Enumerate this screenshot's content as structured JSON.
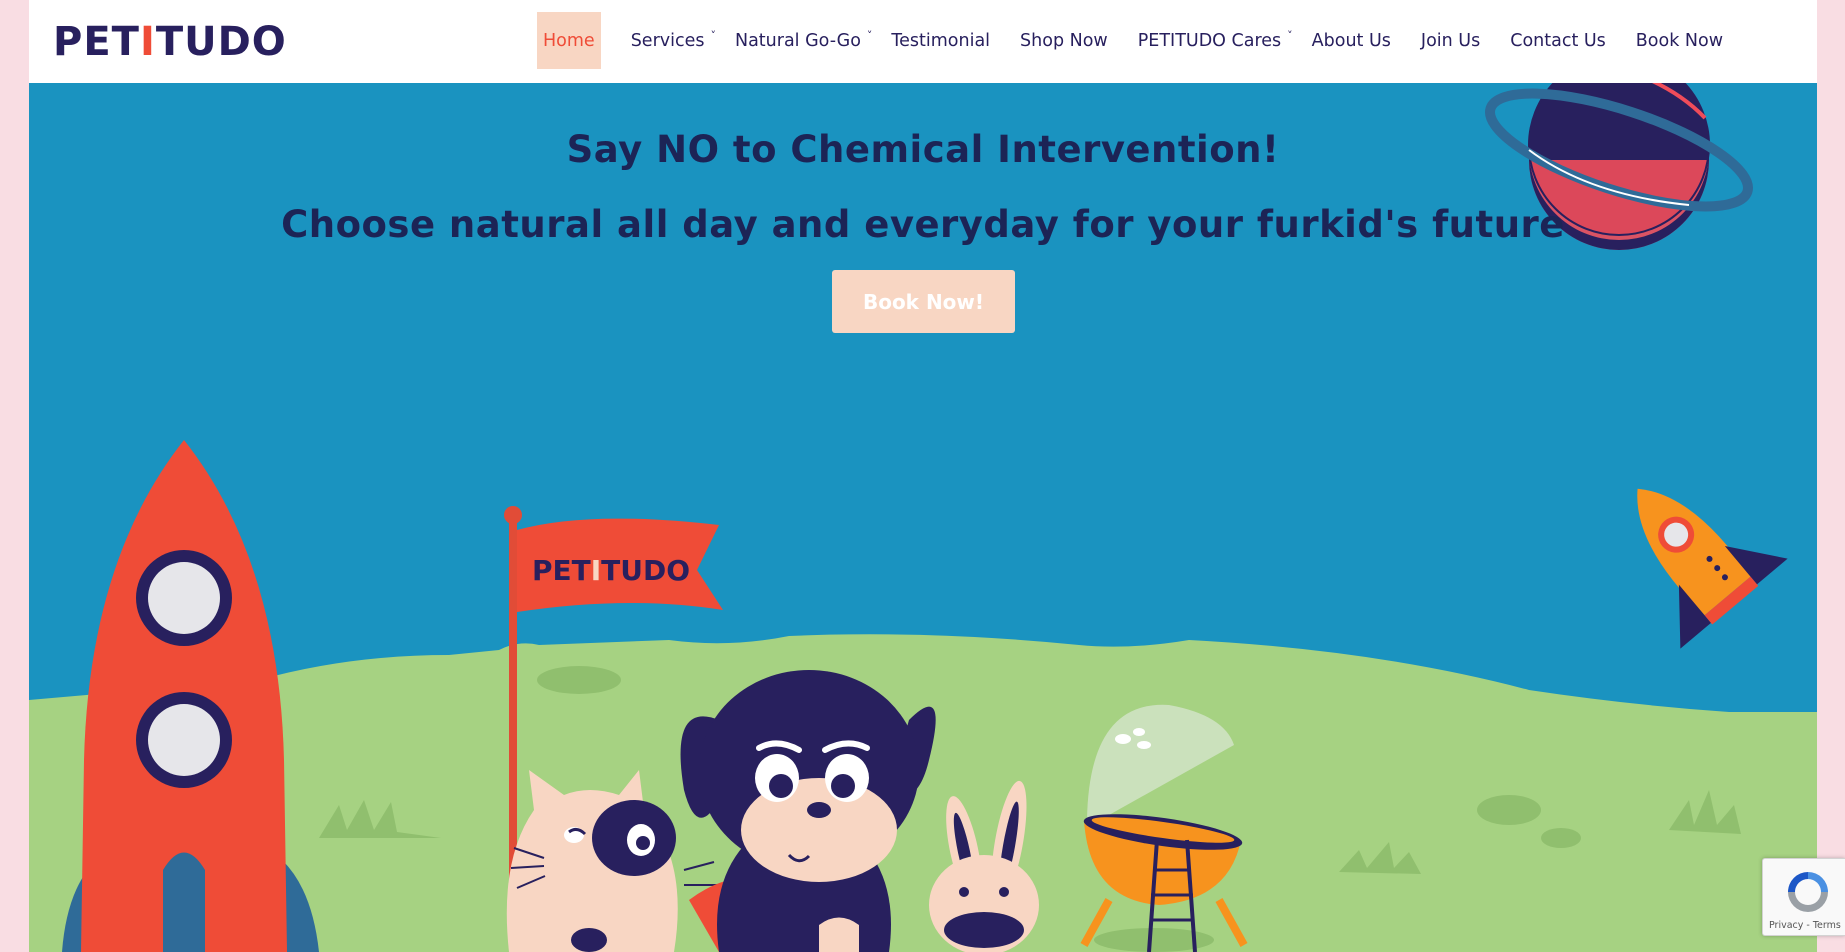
{
  "brand": {
    "logo_part1": "PET",
    "logo_bone": "I",
    "logo_part2": "TUDO"
  },
  "nav": {
    "items": [
      {
        "label": "Home",
        "active": true,
        "dropdown": false
      },
      {
        "label": "Services",
        "dropdown": true
      },
      {
        "label": "Natural Go-Go",
        "dropdown": true
      },
      {
        "label": "Testimonial",
        "dropdown": false
      },
      {
        "label": "Shop Now",
        "dropdown": false
      },
      {
        "label": "PETITUDO Cares",
        "dropdown": true
      },
      {
        "label": "About Us",
        "dropdown": false
      },
      {
        "label": "Join Us",
        "dropdown": false
      },
      {
        "label": "Contact Us",
        "dropdown": false
      },
      {
        "label": "Book Now",
        "dropdown": false
      }
    ],
    "chevron": "˅"
  },
  "hero": {
    "title": "Say NO to Chemical Intervention!",
    "subtitle": "Choose natural all day and everyday for your furkid's future",
    "cta_label": "Book Now!"
  },
  "flag": {
    "text_part1": "PET",
    "text_bone": "I",
    "text_part2": "TUDO"
  },
  "recaptcha": {
    "links": "Privacy - Terms"
  },
  "colors": {
    "navy": "#28205e",
    "accent": "#ef4c37",
    "sky": "#1a93c0",
    "grass": "#a6d282",
    "peach": "#f8d6c3",
    "orange": "#f7931e"
  }
}
